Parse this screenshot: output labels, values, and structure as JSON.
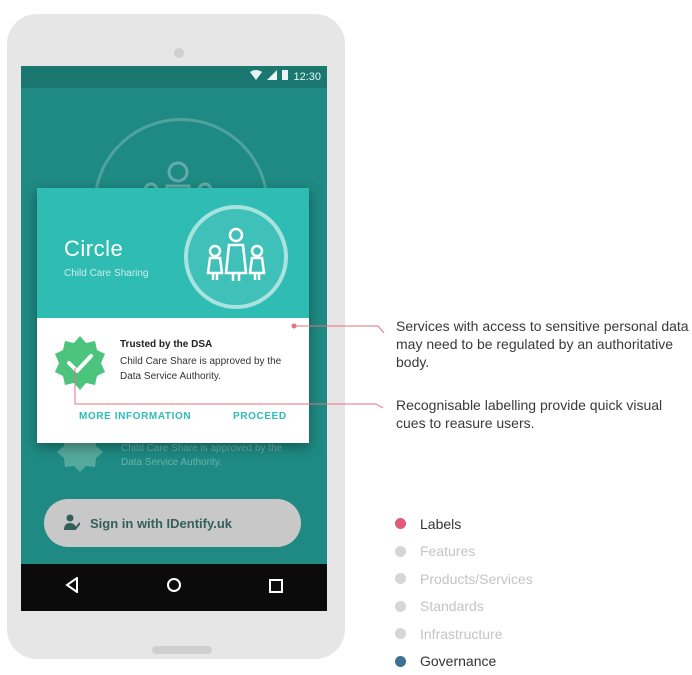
{
  "status_bar": {
    "time": "12:30"
  },
  "background_screen": {
    "trust_text": "Child Care Share is approved by the Data Service Authority.",
    "signin_label": "Sign in with IDentify.uk"
  },
  "card": {
    "title": "Circle",
    "subtitle": "Child Care Sharing",
    "trust_title": "Trusted by the DSA",
    "trust_description": "Child Care Share is approved by the Data Service Authority.",
    "more_info_label": "MORE INFORMATION",
    "proceed_label": "PROCEED"
  },
  "annotations": [
    {
      "text": "Services with access to sensitive personal data may need to be regulated by an authoritative body."
    },
    {
      "text": "Recognisable labelling provide quick visual cues to reasure users."
    }
  ],
  "legend": [
    {
      "label": "Labels",
      "color": "#e05a7c",
      "text_color": "#333333"
    },
    {
      "label": "Features",
      "color": "#d6d6d6",
      "text_color": "#c4c4c4"
    },
    {
      "label": "Products/Services",
      "color": "#d6d6d6",
      "text_color": "#c4c4c4"
    },
    {
      "label": "Standards",
      "color": "#d6d6d6",
      "text_color": "#c4c4c4"
    },
    {
      "label": "Infrastructure",
      "color": "#d6d6d6",
      "text_color": "#c4c4c4"
    },
    {
      "label": "Governance",
      "color": "#3f6f93",
      "text_color": "#333333"
    }
  ],
  "colors": {
    "screen_teal": "#1e8a83",
    "card_teal": "#2fbcb3",
    "badge_green": "#4dc47e",
    "annotation_line": "#e9707d"
  },
  "icons": {
    "nav": [
      "back-triangle-icon",
      "home-circle-icon",
      "recents-square-icon"
    ]
  }
}
